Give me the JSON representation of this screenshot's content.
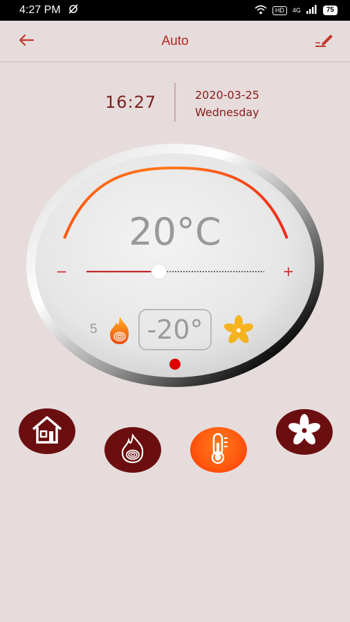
{
  "status_bar": {
    "time": "4:27 PM",
    "hd_label": "HD",
    "network_label": "4G",
    "battery": "75"
  },
  "header": {
    "title": "Auto"
  },
  "clock": {
    "time": "16:27",
    "date": "2020-03-25",
    "weekday": "Wednesday"
  },
  "thermostat": {
    "current_temp": "20°C",
    "setpoint": "-20°",
    "level": "5",
    "slider_fraction": 0.45,
    "minus_symbol": "−",
    "plus_symbol": "+"
  },
  "modes": [
    {
      "name": "home"
    },
    {
      "name": "heat"
    },
    {
      "name": "thermometer",
      "selected": true
    },
    {
      "name": "fan"
    }
  ],
  "colors": {
    "accent": "#b3261e",
    "mode_bg": "#6b0e10",
    "mode_selected": "#ff5a10",
    "arc": "#ff5a10",
    "indicator": "#e00000"
  }
}
